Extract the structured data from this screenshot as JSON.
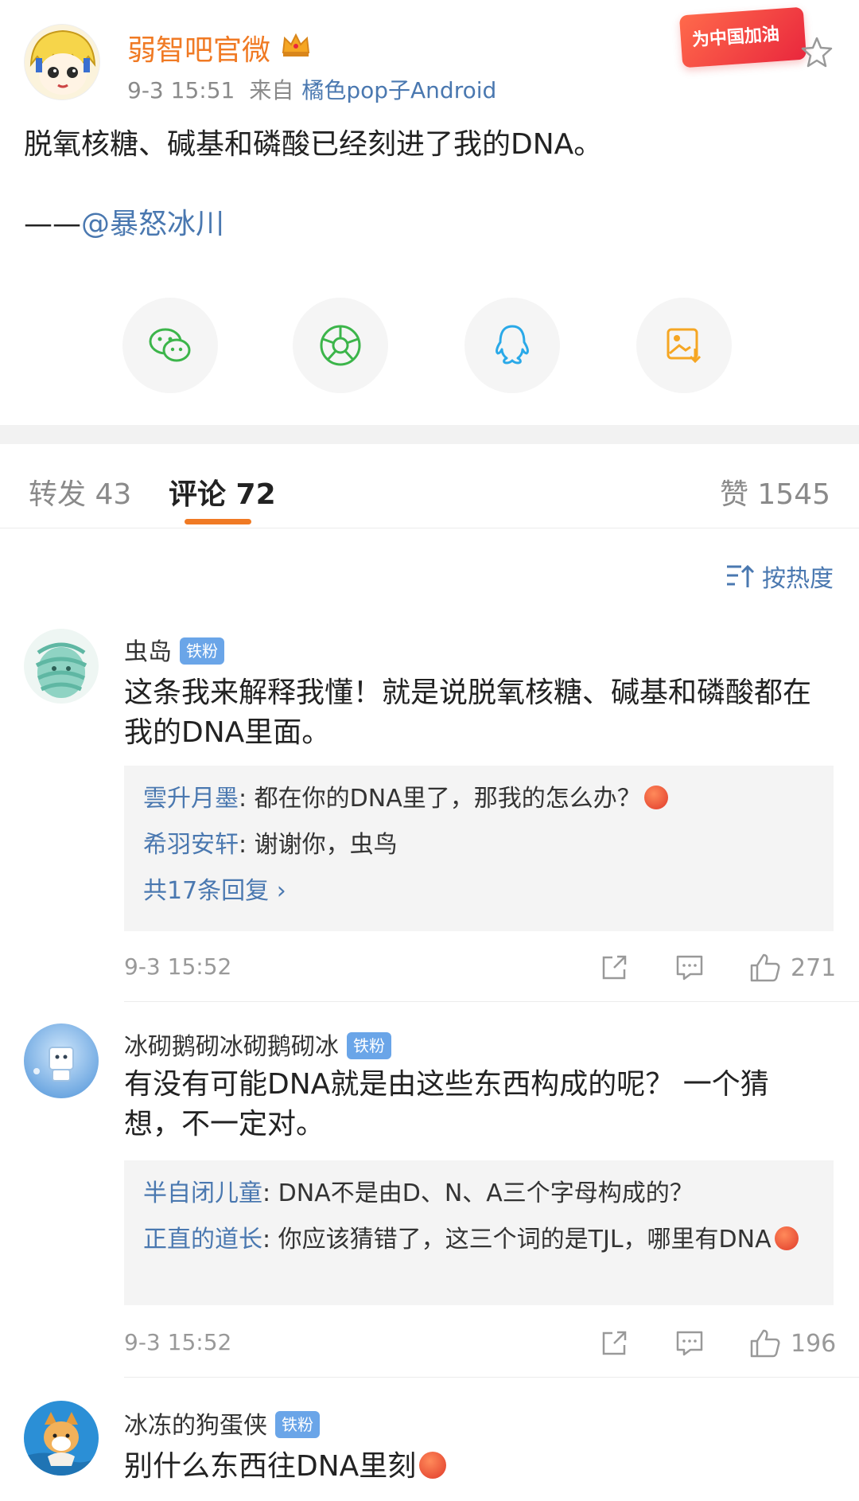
{
  "post": {
    "author": "弱智吧官微",
    "time": "9-3 15:51",
    "source_prefix": "来自",
    "source": "橘色pop子Android",
    "badge_text": "为中国加油",
    "text": "脱氧核糖、碱基和磷酸已经刻进了我的DNA。",
    "credit_dash": "——",
    "credit_mention": "@暴怒冰川"
  },
  "share": [
    {
      "name": "wechat-icon",
      "color": "#3cb54a"
    },
    {
      "name": "moments-icon",
      "color": "#3cb54a"
    },
    {
      "name": "qq-icon",
      "color": "#2aa9e8"
    },
    {
      "name": "save-image-icon",
      "color": "#f5a623"
    }
  ],
  "tabs": {
    "repost": "转发 43",
    "comment": "评论 72",
    "like": "赞 1545"
  },
  "sort_label": "按热度",
  "comments": [
    {
      "name": "虫岛",
      "badge": "铁粉",
      "text": "这条我来解释我懂！就是说脱氧核糖、碱基和磷酸都在我的DNA里面。",
      "replies": [
        {
          "name": "雲升月墨",
          "sep": ": ",
          "text": "都在你的DNA里了，那我的怎么办？"
        },
        {
          "name": "希羽安轩",
          "sep": ": ",
          "text": "谢谢你，虫鸟"
        }
      ],
      "more": "共17条回复 ›",
      "time": "9-3 15:52",
      "likes": "271"
    },
    {
      "name": "冰砌鹅砌冰砌鹅砌冰",
      "badge": "铁粉",
      "text": "有没有可能DNA就是由这些东西构成的呢？ 一个猜想，不一定对。",
      "replies": [
        {
          "name": "半自闭儿童",
          "sep": ": ",
          "text": "DNA不是由D、N、A三个字母构成的？"
        },
        {
          "name": "正直的道长",
          "sep": ": ",
          "text": "你应该猜错了，这三个词的是TJL，哪里有DNA"
        }
      ],
      "time": "9-3 15:52",
      "likes": "196"
    },
    {
      "name": "冰冻的狗蛋侠",
      "badge": "铁粉",
      "text": "别什么东西往DNA里刻"
    }
  ],
  "colors": {
    "accent": "#f07a24",
    "link": "#4a78b0",
    "badge": "#6aa5e8"
  }
}
